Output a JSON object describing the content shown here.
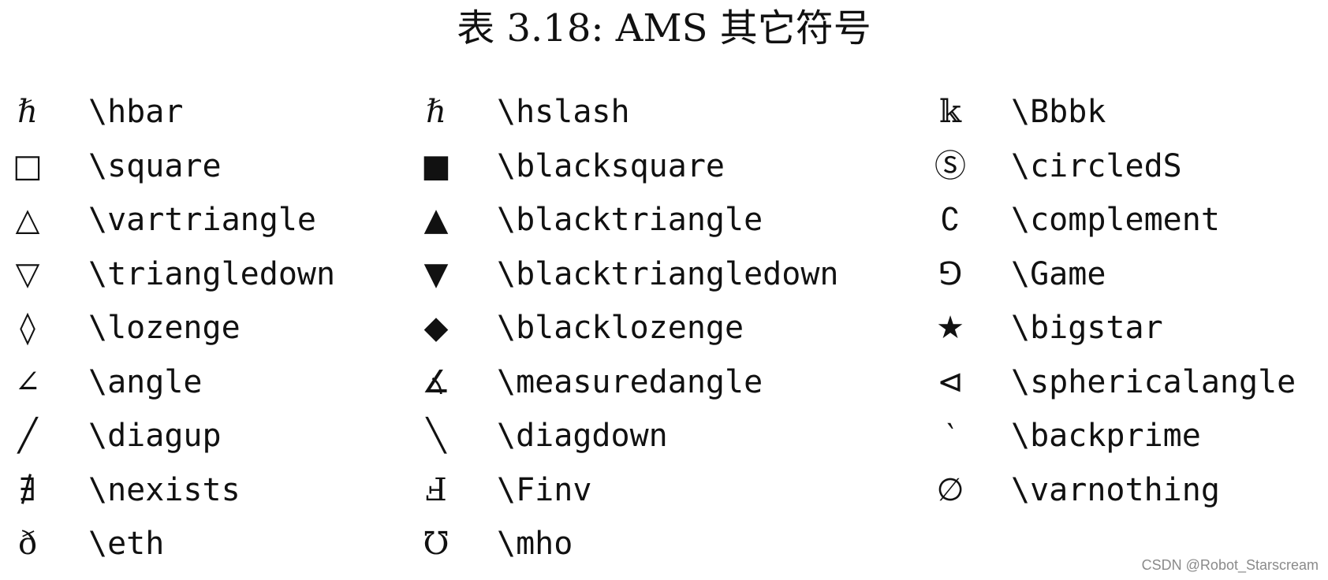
{
  "caption": "表 3.18: AMS 其它符号",
  "columns": [
    {
      "rows": [
        {
          "symbol": "ℏ",
          "icon": "hbar-icon",
          "command": "\\hbar"
        },
        {
          "symbol": "□",
          "icon": "square-icon",
          "command": "\\square"
        },
        {
          "symbol": "△",
          "icon": "vartriangle-icon",
          "command": "\\vartriangle"
        },
        {
          "symbol": "▽",
          "icon": "triangledown-icon",
          "command": "\\triangledown"
        },
        {
          "symbol": "◊",
          "icon": "lozenge-icon",
          "command": "\\lozenge"
        },
        {
          "symbol": "∠",
          "icon": "angle-icon",
          "command": "\\angle"
        },
        {
          "symbol": "╱",
          "icon": "diagup-icon",
          "command": "\\diagup"
        },
        {
          "symbol": "∄",
          "icon": "nexists-icon",
          "command": "\\nexists"
        },
        {
          "symbol": "ð",
          "icon": "eth-icon",
          "command": "\\eth"
        }
      ]
    },
    {
      "rows": [
        {
          "symbol": "ℏ",
          "icon": "hslash-icon",
          "command": "\\hslash"
        },
        {
          "symbol": "■",
          "icon": "blacksquare-icon",
          "command": "\\blacksquare"
        },
        {
          "symbol": "▲",
          "icon": "blacktriangle-icon",
          "command": "\\blacktriangle"
        },
        {
          "symbol": "▼",
          "icon": "blacktriangledown-icon",
          "command": "\\blacktriangledown"
        },
        {
          "symbol": "◆",
          "icon": "blacklozenge-icon",
          "command": "\\blacklozenge"
        },
        {
          "symbol": "∡",
          "icon": "measuredangle-icon",
          "command": "\\measuredangle"
        },
        {
          "symbol": "╲",
          "icon": "diagdown-icon",
          "command": "\\diagdown"
        },
        {
          "symbol": "Ⅎ",
          "icon": "finv-icon",
          "command": "\\Finv"
        },
        {
          "symbol": "℧",
          "icon": "mho-icon",
          "command": "\\mho"
        }
      ]
    },
    {
      "rows": [
        {
          "symbol": "𝕜",
          "icon": "bbbk-icon",
          "command": "\\Bbbk"
        },
        {
          "symbol": "Ⓢ",
          "icon": "circleds-icon",
          "command": "\\circledS"
        },
        {
          "symbol": "∁",
          "icon": "complement-icon",
          "command": "\\complement"
        },
        {
          "symbol": "⅁",
          "icon": "game-icon",
          "command": "\\Game"
        },
        {
          "symbol": "★",
          "icon": "bigstar-icon",
          "command": "\\bigstar"
        },
        {
          "symbol": "⊲",
          "icon": "sphericalangle-icon",
          "command": "\\sphericalangle"
        },
        {
          "symbol": "‵",
          "icon": "backprime-icon",
          "command": "\\backprime"
        },
        {
          "symbol": "∅",
          "icon": "varnothing-icon",
          "command": "\\varnothing"
        }
      ]
    }
  ],
  "watermark": "CSDN @Robot_Starscream"
}
